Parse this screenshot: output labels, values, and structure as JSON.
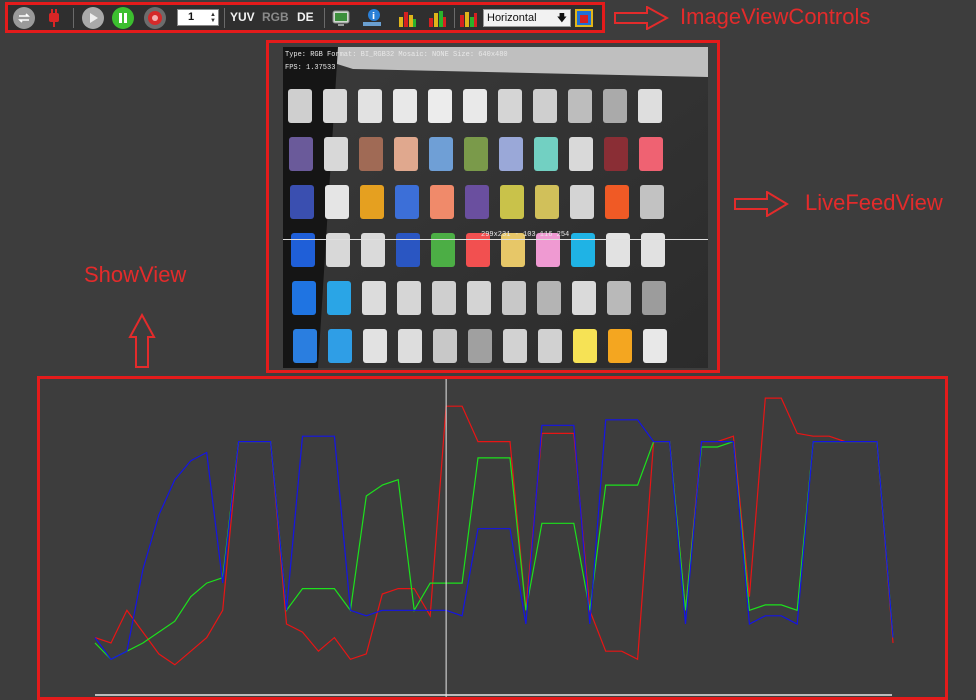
{
  "toolbar": {
    "frame_count": "1",
    "format_labels": [
      "YUV",
      "RGB",
      "DE"
    ],
    "orientation": "Horizontal",
    "icons": [
      "swap-icon",
      "plug-icon",
      "play-icon",
      "pause-icon",
      "record-icon",
      "monitor-icon",
      "info-icon",
      "histogram-red-icon",
      "histogram-green-icon",
      "histogram-blue-icon",
      "color-picker-icon"
    ]
  },
  "callouts": {
    "controls": "ImageViewControls",
    "live": "LiveFeedView",
    "show": "ShowView"
  },
  "live_feed": {
    "info_line": "Type: RGB Format: BI_RGB32 Mosaic: NONE Size: 640x480",
    "fps": "FPS: 1.37533",
    "probe": "299x231 - 103 116 254"
  },
  "colors": {
    "accent": "#e41b1b",
    "red": "#e81515",
    "green": "#1de11d",
    "blue": "#1414e6"
  },
  "chart_data": {
    "type": "line",
    "title": "",
    "xlabel": "",
    "ylabel": "",
    "x": [
      0,
      2,
      4,
      6,
      8,
      10,
      12,
      14,
      16,
      18,
      20,
      22,
      24,
      26,
      28,
      30,
      32,
      34,
      36,
      38,
      40,
      42,
      44,
      46,
      48,
      50,
      52,
      54,
      56,
      58,
      60,
      62,
      64,
      66,
      68,
      70,
      72,
      74,
      76,
      78,
      80,
      82,
      84,
      86,
      88,
      90,
      92,
      94,
      96,
      98,
      100
    ],
    "series": [
      {
        "name": "red",
        "values": [
          20,
          18,
          30,
          22,
          14,
          10,
          15,
          20,
          30,
          92,
          92,
          92,
          25,
          22,
          15,
          20,
          12,
          14,
          36,
          38,
          38,
          28,
          105,
          105,
          92,
          92,
          92,
          30,
          95,
          95,
          95,
          30,
          15,
          15,
          12,
          92,
          92,
          30,
          92,
          92,
          94,
          35,
          108,
          108,
          95,
          94,
          94,
          92,
          92,
          92,
          18
        ]
      },
      {
        "name": "green",
        "values": [
          18,
          12,
          15,
          18,
          22,
          26,
          35,
          40,
          42,
          92,
          92,
          92,
          30,
          38,
          38,
          38,
          30,
          72,
          76,
          78,
          30,
          40,
          40,
          40,
          86,
          86,
          86,
          30,
          62,
          62,
          62,
          30,
          76,
          76,
          76,
          92,
          92,
          30,
          90,
          90,
          92,
          30,
          32,
          32,
          30,
          92,
          92,
          92,
          92,
          92,
          20
        ]
      },
      {
        "name": "blue",
        "values": [
          20,
          12,
          15,
          45,
          65,
          78,
          85,
          88,
          40,
          92,
          92,
          92,
          30,
          94,
          94,
          94,
          30,
          28,
          30,
          30,
          30,
          30,
          30,
          28,
          60,
          60,
          60,
          25,
          98,
          98,
          98,
          25,
          100,
          100,
          100,
          92,
          92,
          25,
          92,
          92,
          92,
          25,
          28,
          28,
          25,
          92,
          92,
          92,
          92,
          92,
          20
        ]
      }
    ],
    "ylim": [
      0,
      115
    ],
    "cursor_x": 44,
    "grid": false
  }
}
